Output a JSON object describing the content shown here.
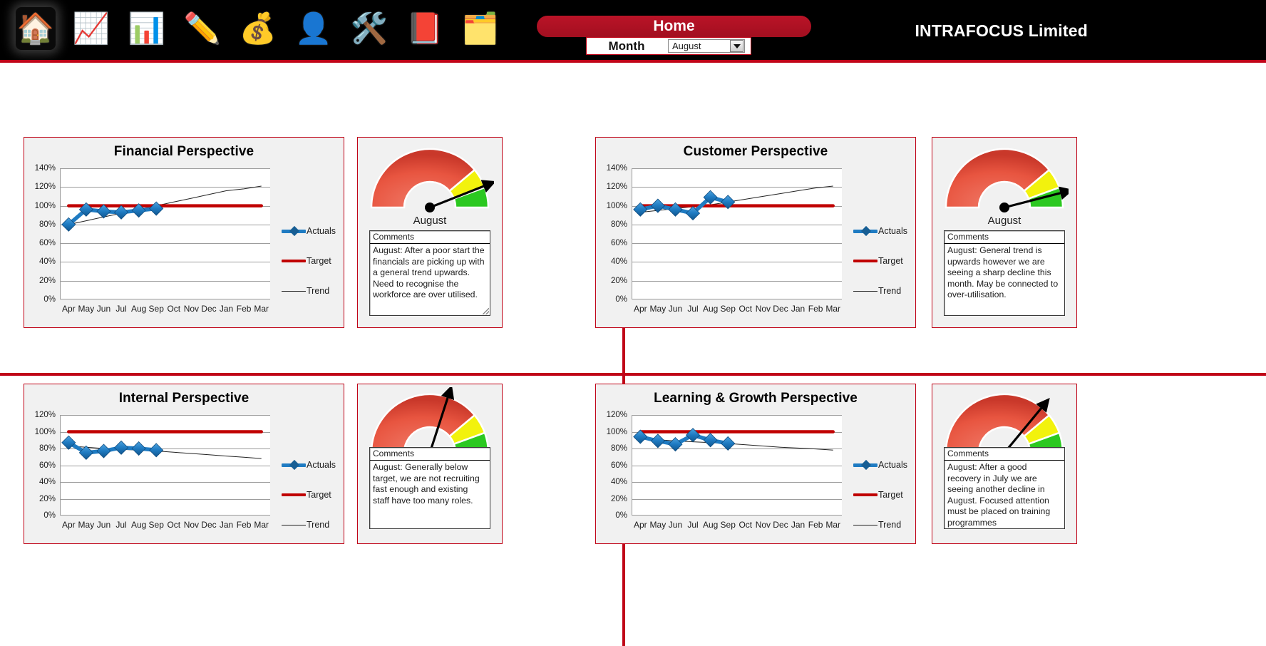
{
  "header": {
    "brand": "INTRAFOCUS Limited",
    "home_label": "Home",
    "month_label": "Month",
    "month_value": "August",
    "icons": [
      {
        "name": "home-icon",
        "glyph": "🏠",
        "title": "Home"
      },
      {
        "name": "presentation-chart-icon",
        "glyph": "📈",
        "title": "Strategy"
      },
      {
        "name": "bar-chart-icon",
        "glyph": "📊",
        "title": "Measures"
      },
      {
        "name": "pencil-icon",
        "glyph": "✏️",
        "title": "Edit"
      },
      {
        "name": "money-coins-icon",
        "glyph": "💰",
        "title": "Financial"
      },
      {
        "name": "person-icon",
        "glyph": "👤",
        "title": "Customer"
      },
      {
        "name": "tools-icon",
        "glyph": "🛠️",
        "title": "Internal"
      },
      {
        "name": "book-icon",
        "glyph": "📕",
        "title": "Learning"
      },
      {
        "name": "folder-icon",
        "glyph": "🗂️",
        "title": "Reports"
      }
    ]
  },
  "legend": {
    "actuals": "Actuals",
    "target": "Target",
    "trend": "Trend"
  },
  "comments_header": "Comments",
  "gauge_caption": "August",
  "months": [
    "Apr",
    "May",
    "Jun",
    "Jul",
    "Aug",
    "Sep",
    "Oct",
    "Nov",
    "Dec",
    "Jan",
    "Feb",
    "Mar"
  ],
  "panels": [
    {
      "id": "financial",
      "title": "Financial Perspective",
      "comment": "August: After a poor start the financials are picking up with a general trend upwards.  Need to recognise the workforce are over utilised.",
      "gauge_value": 88,
      "chart_data": {
        "type": "line",
        "title": "Financial Perspective",
        "xlabel": "",
        "ylabel": "",
        "ylim": [
          0,
          140
        ],
        "yticks": [
          0,
          20,
          40,
          60,
          80,
          100,
          120,
          140
        ],
        "ytick_labels": [
          "0%",
          "20%",
          "40%",
          "60%",
          "80%",
          "100%",
          "120%",
          "140%"
        ],
        "categories": [
          "Apr",
          "May",
          "Jun",
          "Jul",
          "Aug",
          "Sep",
          "Oct",
          "Nov",
          "Dec",
          "Jan",
          "Feb",
          "Mar"
        ],
        "grid": true,
        "legend_position": "right",
        "series": [
          {
            "name": "Actuals",
            "color": "#1F7BC2",
            "values": [
              80,
              96,
              94,
              93,
              95,
              97,
              null,
              null,
              null,
              null,
              null,
              null
            ]
          },
          {
            "name": "Target",
            "color": "#C00000",
            "values": [
              100,
              100,
              100,
              100,
              100,
              100,
              100,
              100,
              100,
              100,
              100,
              100
            ]
          },
          {
            "name": "Trend",
            "color": "#222222",
            "values": [
              80,
              84,
              88,
              92,
              96,
              100,
              104,
              108,
              112,
              116,
              118,
              121
            ]
          }
        ]
      }
    },
    {
      "id": "customer",
      "title": "Customer Perspective",
      "comment": "August: General trend is upwards however we are seeing a sharp decline this month.  May be connected to over-utilisation.",
      "gauge_value": 92,
      "chart_data": {
        "type": "line",
        "title": "Customer Perspective",
        "xlabel": "",
        "ylabel": "",
        "ylim": [
          0,
          140
        ],
        "yticks": [
          0,
          20,
          40,
          60,
          80,
          100,
          120,
          140
        ],
        "ytick_labels": [
          "0%",
          "20%",
          "40%",
          "60%",
          "80%",
          "100%",
          "120%",
          "140%"
        ],
        "categories": [
          "Apr",
          "May",
          "Jun",
          "Jul",
          "Aug",
          "Sep",
          "Oct",
          "Nov",
          "Dec",
          "Jan",
          "Feb",
          "Mar"
        ],
        "grid": true,
        "legend_position": "right",
        "series": [
          {
            "name": "Actuals",
            "color": "#1F7BC2",
            "values": [
              96,
              100,
              96,
              92,
              109,
              104,
              null,
              null,
              null,
              null,
              null,
              null
            ]
          },
          {
            "name": "Target",
            "color": "#C00000",
            "values": [
              100,
              100,
              100,
              100,
              100,
              100,
              100,
              100,
              100,
              100,
              100,
              100
            ]
          },
          {
            "name": "Trend",
            "color": "#222222",
            "values": [
              93,
              95,
              97,
              99,
              101,
              104,
              107,
              110,
              113,
              116,
              119,
              121
            ]
          }
        ]
      }
    },
    {
      "id": "internal",
      "title": "Internal Perspective",
      "comment": "August: Generally below target, we are not recruiting fast enough and existing staff have too many roles.",
      "gauge_value": 60,
      "chart_data": {
        "type": "line",
        "title": "Internal Perspective",
        "xlabel": "",
        "ylabel": "",
        "ylim": [
          0,
          120
        ],
        "yticks": [
          0,
          20,
          40,
          60,
          80,
          100,
          120
        ],
        "ytick_labels": [
          "0%",
          "20%",
          "40%",
          "60%",
          "80%",
          "100%",
          "120%"
        ],
        "categories": [
          "Apr",
          "May",
          "Jun",
          "Jul",
          "Aug",
          "Sep",
          "Oct",
          "Nov",
          "Dec",
          "Jan",
          "Feb",
          "Mar"
        ],
        "grid": true,
        "legend_position": "right",
        "series": [
          {
            "name": "Actuals",
            "color": "#1F7BC2",
            "values": [
              87,
              75,
              77,
              81,
              80,
              78,
              null,
              null,
              null,
              null,
              null,
              null
            ]
          },
          {
            "name": "Target",
            "color": "#C00000",
            "values": [
              100,
              100,
              100,
              100,
              100,
              100,
              100,
              100,
              100,
              100,
              100,
              100
            ]
          },
          {
            "name": "Trend",
            "color": "#222222",
            "values": [
              83,
              81.5,
              80,
              79,
              78,
              77,
              75.5,
              74,
              72.5,
              71,
              69.5,
              68
            ]
          }
        ]
      }
    },
    {
      "id": "learning-growth",
      "title": "Learning & Growth Perspective",
      "comment": "August: After a good recovery in July we are seeing another decline in August.  Focused attention must be placed on training programmes",
      "gauge_value": 72,
      "chart_data": {
        "type": "line",
        "title": "Learning & Growth Perspective",
        "xlabel": "",
        "ylabel": "",
        "ylim": [
          0,
          120
        ],
        "yticks": [
          0,
          20,
          40,
          60,
          80,
          100,
          120
        ],
        "ytick_labels": [
          "0%",
          "20%",
          "40%",
          "60%",
          "80%",
          "100%",
          "120%"
        ],
        "categories": [
          "Apr",
          "May",
          "Jun",
          "Jul",
          "Aug",
          "Sep",
          "Oct",
          "Nov",
          "Dec",
          "Jan",
          "Feb",
          "Mar"
        ],
        "grid": true,
        "legend_position": "right",
        "series": [
          {
            "name": "Actuals",
            "color": "#1F7BC2",
            "values": [
              94,
              89,
              85,
              96,
              90,
              86,
              null,
              null,
              null,
              null,
              null,
              null
            ]
          },
          {
            "name": "Target",
            "color": "#C00000",
            "values": [
              100,
              100,
              100,
              100,
              100,
              100,
              100,
              100,
              100,
              100,
              100,
              100
            ]
          },
          {
            "name": "Trend",
            "color": "#222222",
            "values": [
              92,
              90.5,
              89,
              88,
              87,
              86,
              84.5,
              83,
              81.5,
              80.5,
              79.5,
              78
            ]
          }
        ]
      }
    }
  ]
}
